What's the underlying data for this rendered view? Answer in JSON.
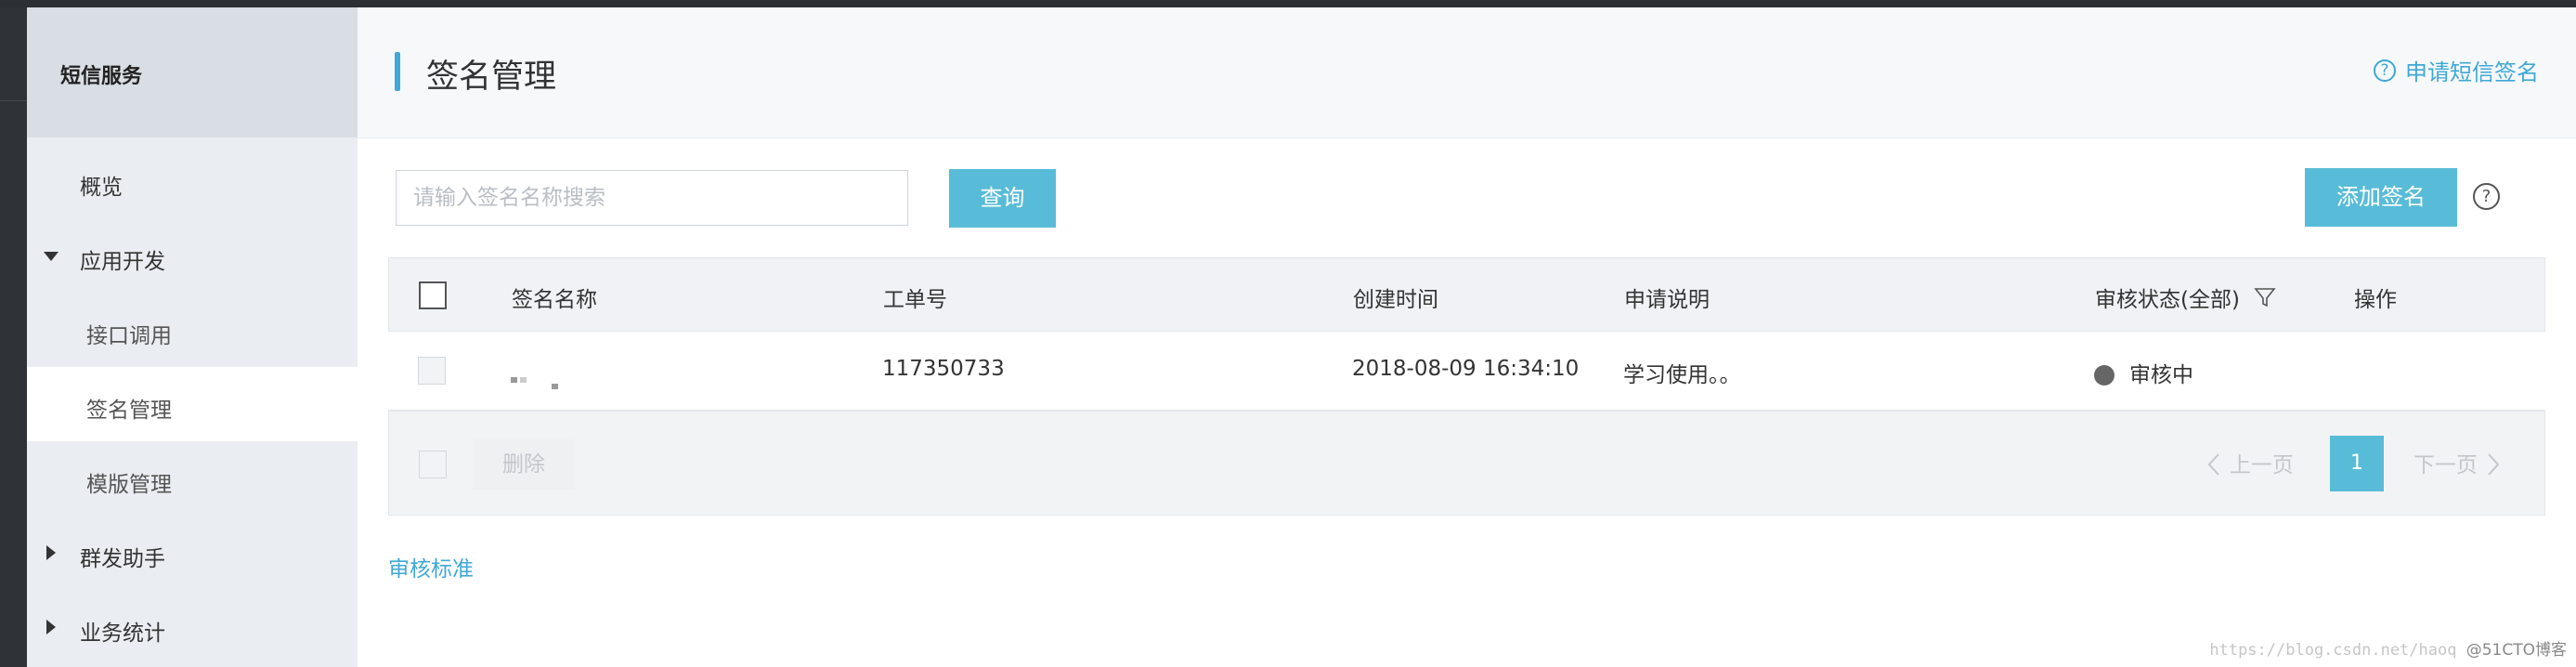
{
  "sidebar": {
    "title": "短信服务",
    "items": [
      {
        "label": "概览"
      },
      {
        "label": "应用开发"
      },
      {
        "label": "接口调用"
      },
      {
        "label": "签名管理"
      },
      {
        "label": "模版管理"
      },
      {
        "label": "群发助手"
      },
      {
        "label": "业务统计"
      }
    ]
  },
  "header": {
    "title": "签名管理",
    "help_link": "申请短信签名"
  },
  "toolbar": {
    "search_placeholder": "请输入签名名称搜索",
    "query_button": "查询",
    "add_button": "添加签名"
  },
  "table": {
    "columns": [
      "签名名称",
      "工单号",
      "创建时间",
      "申请说明",
      "审核状态(全部)",
      "操作"
    ],
    "rows": [
      {
        "ticket": "117350733",
        "created": "2018-08-09 16:34:10",
        "description": "学习使用。。",
        "status": "审核中",
        "status_color": "#666666"
      }
    ]
  },
  "footer": {
    "delete_button": "删除",
    "prev": "上一页",
    "current_page": "1",
    "next": "下一页"
  },
  "links": {
    "review_standard": "审核标准"
  },
  "watermark": {
    "url": "https://blog.csdn.net/haoq",
    "source": "@51CTO博客"
  },
  "colors": {
    "accent": "#3fa8d6",
    "button": "#58bcd8"
  }
}
